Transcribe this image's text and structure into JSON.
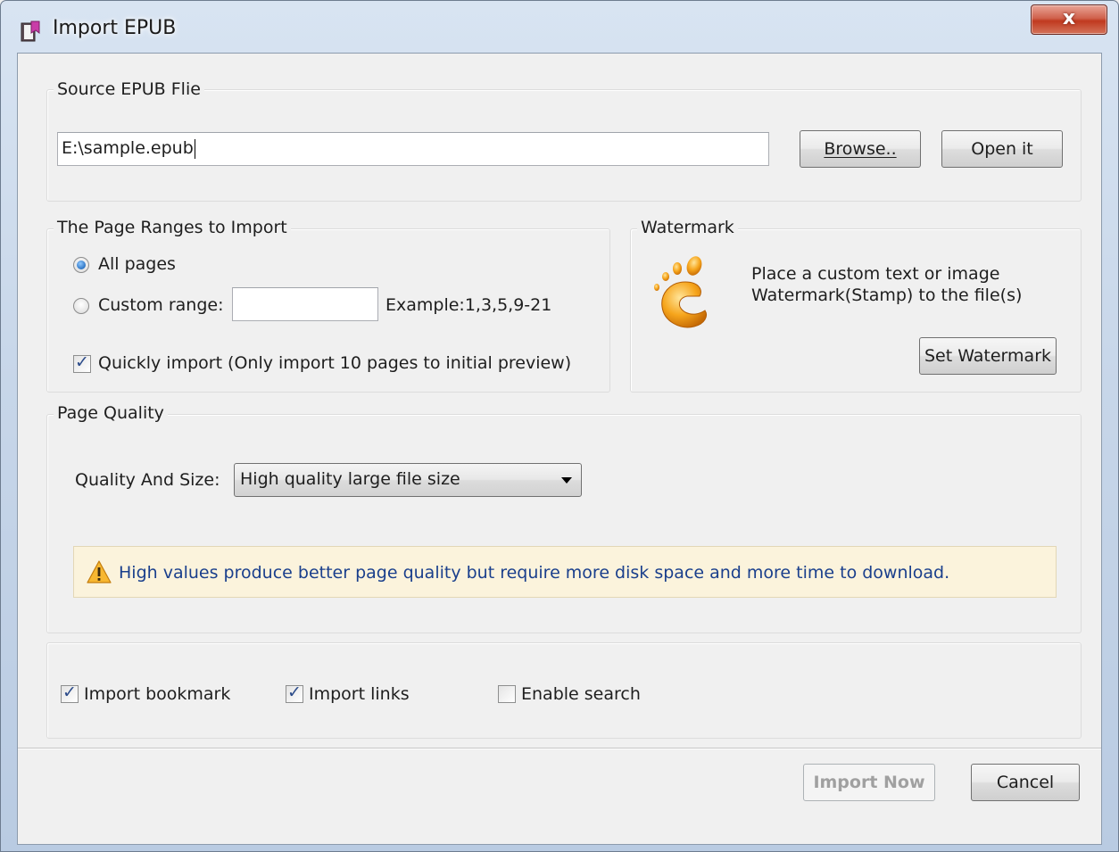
{
  "window": {
    "title": "Import EPUB",
    "close_label": "x"
  },
  "source": {
    "group_label": "Source EPUB Flie",
    "path_value": "E:\\sample.epub",
    "browse_label": "Browse..",
    "open_label": "Open it"
  },
  "page_ranges": {
    "group_label": "The Page Ranges to Import",
    "all_pages_label": "All pages",
    "all_pages_checked": true,
    "custom_range_label": "Custom range:",
    "custom_range_checked": false,
    "custom_range_value": "",
    "example_label": "Example:1,3,5,9-21",
    "quick_import_label": "Quickly import (Only import 10 pages to  initial  preview)",
    "quick_import_checked": true
  },
  "watermark": {
    "group_label": "Watermark",
    "icon": "gimp-footprint-icon",
    "description_line1": "Place a custom text or image",
    "description_line2": "Watermark(Stamp) to the file(s)",
    "set_button_label": "Set Watermark"
  },
  "quality": {
    "group_label": "Page Quality",
    "field_label": "Quality And Size:",
    "selected_value": "High quality large file size",
    "warning_icon": "warning-icon",
    "warning_text": "High values produce better page quality but require more disk space and more time to download."
  },
  "options": {
    "import_bookmark_label": "Import bookmark",
    "import_bookmark_checked": true,
    "import_links_label": "Import links",
    "import_links_checked": true,
    "enable_search_label": "Enable search",
    "enable_search_checked": false
  },
  "footer": {
    "import_now_label": "Import Now",
    "cancel_label": "Cancel"
  },
  "colors": {
    "warning_background": "#fbf3dc",
    "warning_text": "#1a3f8c",
    "close_button": "#c0391f"
  }
}
